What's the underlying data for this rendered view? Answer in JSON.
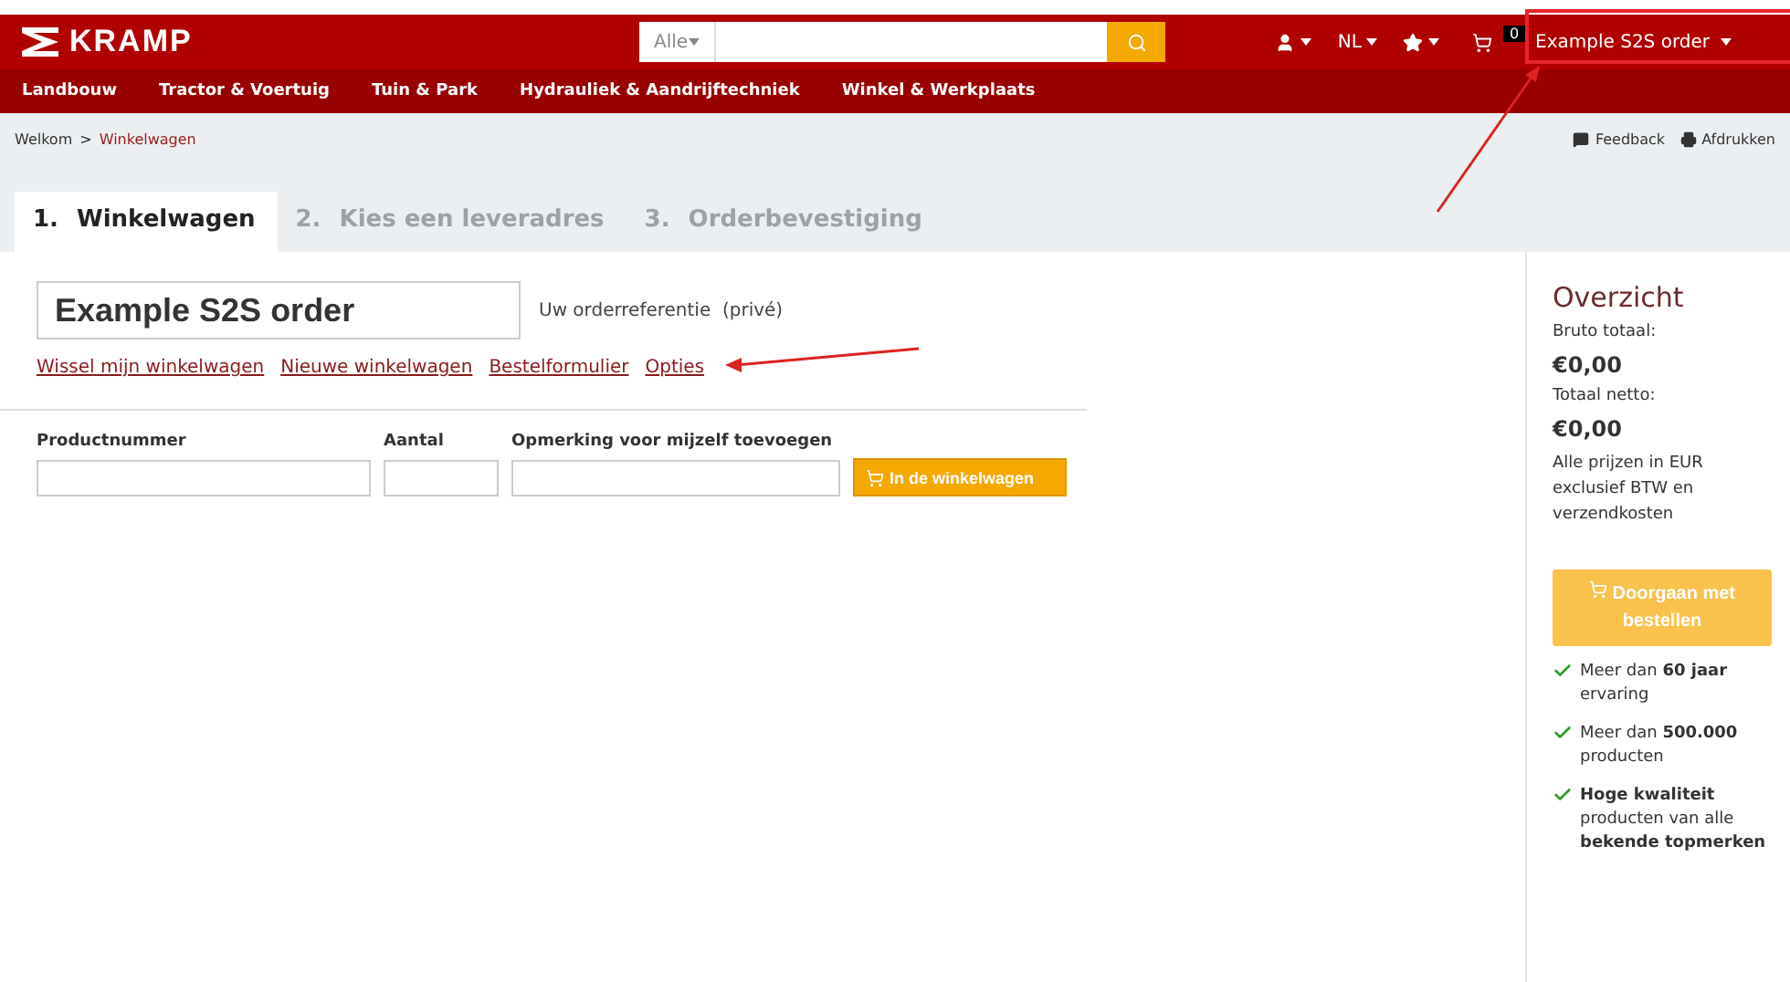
{
  "header": {
    "logo": "KRAMP",
    "search": {
      "scope": "Alle"
    },
    "language": "NL",
    "cart": {
      "count": "0",
      "name": "Example S2S order"
    }
  },
  "nav": [
    "Landbouw",
    "Tractor & Voertuig",
    "Tuin & Park",
    "Hydrauliek & Aandrijftechniek",
    "Winkel & Werkplaats"
  ],
  "breadcrumb": [
    "Welkom",
    ">",
    "Winkelwagen"
  ],
  "actions": [
    "Feedback",
    "Afdrukken"
  ],
  "steps": [
    {
      "number": "1.",
      "label": "Winkelwagen",
      "selected": true
    },
    {
      "number": "2.",
      "label": "Kies een leveradres",
      "selected": false
    },
    {
      "number": "3.",
      "label": "Orderbevestiging",
      "selected": false
    }
  ],
  "order": {
    "reference": "Example S2S order",
    "reference_label": "Uw orderreferentie  (privé)"
  },
  "links": [
    "Wissel mijn winkelwagen",
    "Nieuwe winkelwagen",
    "Bestelformulier",
    "Opties"
  ],
  "quick_add": {
    "columns": [
      "Productnummer",
      "Aantal",
      "Opmerking voor mijzelf toevoegen"
    ],
    "button": "In de winkelwagen"
  },
  "summary": {
    "title": "Overzicht",
    "gross_label": "Bruto totaal:",
    "gross": "€0,00",
    "net_label": "Totaal netto:",
    "net": "€0,00",
    "note": "Alle prijzen in EUR exclusief BTW en verzendkosten",
    "button": "Doorgaan met bestellen",
    "benefits": [
      "Meer dan **60 jaar** ervaring",
      "Meer dan **500.000** producten",
      "**Hoge kwaliteit** producten van alle **bekende topmerken**"
    ]
  }
}
